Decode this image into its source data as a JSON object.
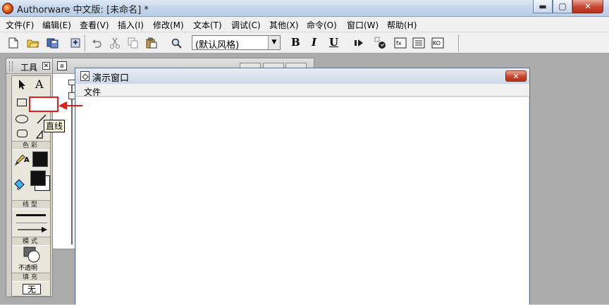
{
  "window": {
    "title": "Authorware 中文版: [未命名] *",
    "buttons": {
      "minimize": "▬",
      "maximize": "▢",
      "close": "✕"
    }
  },
  "menubar": {
    "items": [
      "文件(F)",
      "编辑(E)",
      "查看(V)",
      "插入(I)",
      "修改(M)",
      "文本(T)",
      "调试(C)",
      "其他(X)",
      "命令(O)",
      "窗口(W)",
      "帮助(H)"
    ]
  },
  "toolbar": {
    "text_style": "(默认风格)",
    "bold": "B",
    "italic": "I",
    "underline": "U"
  },
  "tools": {
    "title": "工具",
    "text_tool": "A",
    "section_color": "色彩",
    "section_line": "线型",
    "section_mode": "模式",
    "mode_value": "不透明",
    "section_fill": "填充",
    "fill_value": "无"
  },
  "tooltip": "直线",
  "presentation": {
    "title": "演示窗口",
    "menu": [
      "文件"
    ]
  },
  "colors": {
    "callout": "#e01e1e",
    "workspace": "#ababab",
    "palette": "#d4d0c8"
  }
}
